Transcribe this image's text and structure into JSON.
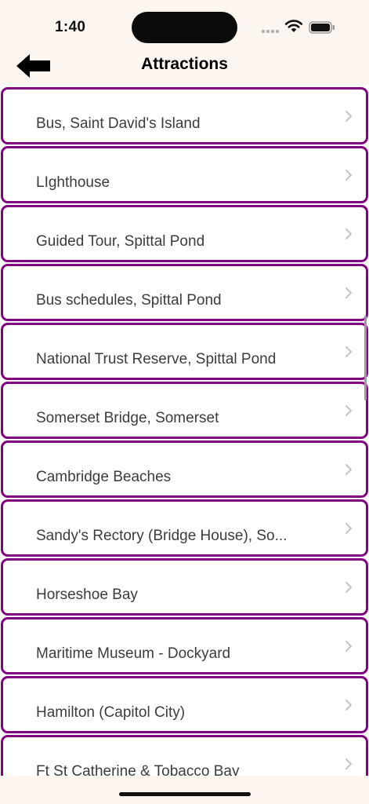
{
  "status_bar": {
    "time": "1:40"
  },
  "nav": {
    "title": "Attractions",
    "back_icon": "arrow-left-icon"
  },
  "attractions": [
    "Bus, Saint David's Island",
    "LIghthouse",
    "Guided Tour, Spittal Pond",
    "Bus schedules, Spittal Pond",
    "National Trust Reserve, Spittal Pond",
    "Somerset Bridge, Somerset",
    "Cambridge Beaches",
    "Sandy's Rectory (Bridge House), So...",
    "Horseshoe Bay",
    "Maritime Museum - Dockyard",
    "Hamilton (Capitol City)",
    "Ft St Catherine & Tobacco Bay"
  ],
  "colors": {
    "row_border": "#800080",
    "bar_background": "#fdf5f0"
  }
}
